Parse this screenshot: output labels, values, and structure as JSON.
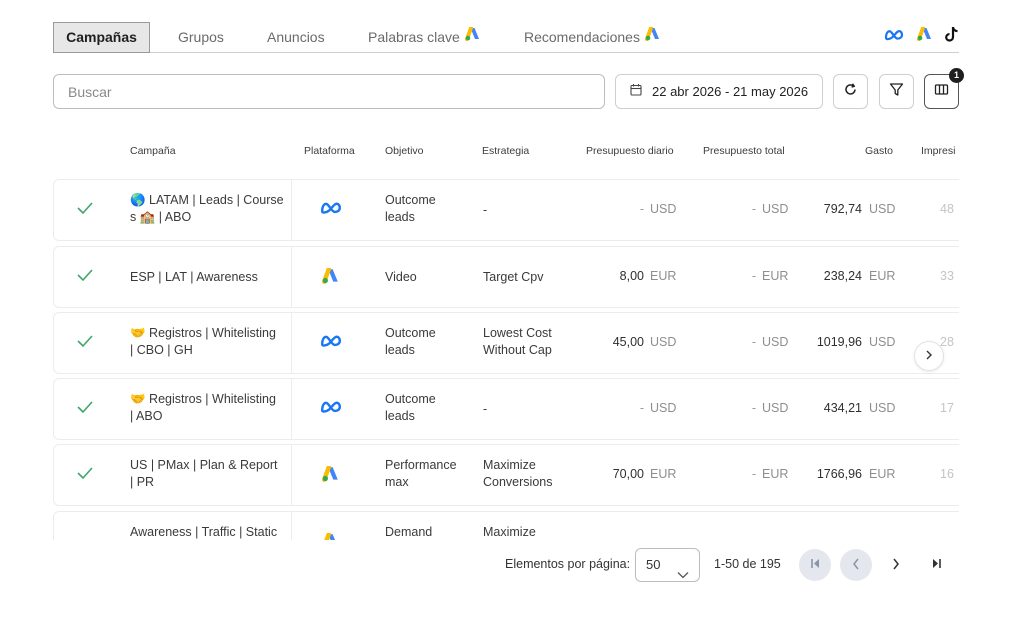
{
  "tabs": [
    {
      "label": "Campañas",
      "active": true
    },
    {
      "label": "Grupos"
    },
    {
      "label": "Anuncios"
    },
    {
      "label": "Palabras clave"
    },
    {
      "label": "Recomendaciones"
    }
  ],
  "platform_icons": [
    "meta-icon",
    "google-ads-icon",
    "tiktok-icon"
  ],
  "search": {
    "placeholder": "Buscar"
  },
  "date_range": "22 abr 2026 - 21 may 2026",
  "columns_badge": "1",
  "table": {
    "headers": [
      "Campaña",
      "Plataforma",
      "Objetivo",
      "Estrategia",
      "Presupuesto diario",
      "Presupuesto total",
      "Gasto",
      "Impresi"
    ],
    "rows": [
      {
        "name_1": "🌎 LATAM | Leads | Course",
        "name_2": "s 🏫 | ABO",
        "platform": "meta",
        "obj_1": "Outcome",
        "obj_2": "leads",
        "strat_1": "-",
        "strat_2": "",
        "daily": "-",
        "daily_cur": "USD",
        "total": "-",
        "total_cur": "USD",
        "spend": "792,74",
        "spend_cur": "USD",
        "impr": "48"
      },
      {
        "name_1": "ESP | LAT | Awareness",
        "name_2": "",
        "platform": "google",
        "obj_1": "Video",
        "obj_2": "",
        "strat_1": "Target Cpv",
        "strat_2": "",
        "daily": "8,00",
        "daily_cur": "EUR",
        "total": "-",
        "total_cur": "EUR",
        "spend": "238,24",
        "spend_cur": "EUR",
        "impr": "33"
      },
      {
        "name_1": "🤝 Registros | Whitelisting",
        "name_2": "| CBO | GH",
        "platform": "meta",
        "obj_1": "Outcome",
        "obj_2": "leads",
        "strat_1": "Lowest Cost",
        "strat_2": "Without Cap",
        "daily": "45,00",
        "daily_cur": "USD",
        "total": "-",
        "total_cur": "USD",
        "spend": "1019,96",
        "spend_cur": "USD",
        "impr": "28"
      },
      {
        "name_1": "🤝 Registros | Whitelisting",
        "name_2": "| ABO",
        "platform": "meta",
        "obj_1": "Outcome",
        "obj_2": "leads",
        "strat_1": "-",
        "strat_2": "",
        "daily": "-",
        "daily_cur": "USD",
        "total": "-",
        "total_cur": "USD",
        "spend": "434,21",
        "spend_cur": "USD",
        "impr": "17"
      },
      {
        "name_1": "US | PMax | Plan & Report",
        "name_2": "| PR",
        "platform": "google",
        "obj_1": "Performance",
        "obj_2": "max",
        "strat_1": "Maximize",
        "strat_2": "Conversions",
        "daily": "70,00",
        "daily_cur": "EUR",
        "total": "-",
        "total_cur": "EUR",
        "spend": "1766,96",
        "spend_cur": "EUR",
        "impr": "16"
      },
      {
        "name_1": "Awareness | Traffic | Static",
        "name_2": "",
        "platform": "google",
        "obj_1": "Demand",
        "obj_2": "",
        "strat_1": "Maximize",
        "strat_2": "",
        "daily": "",
        "daily_cur": "",
        "total": "",
        "total_cur": "",
        "spend": "",
        "spend_cur": "",
        "impr": ""
      }
    ]
  },
  "pagination": {
    "label": "Elementos por página:",
    "per_page": "50",
    "range": "1-50 de 195"
  },
  "colors": {
    "meta": "#1877f2",
    "google_blue": "#4285f4",
    "google_yellow": "#fbbc04",
    "google_green": "#34a853",
    "check": "#3fa66b"
  }
}
